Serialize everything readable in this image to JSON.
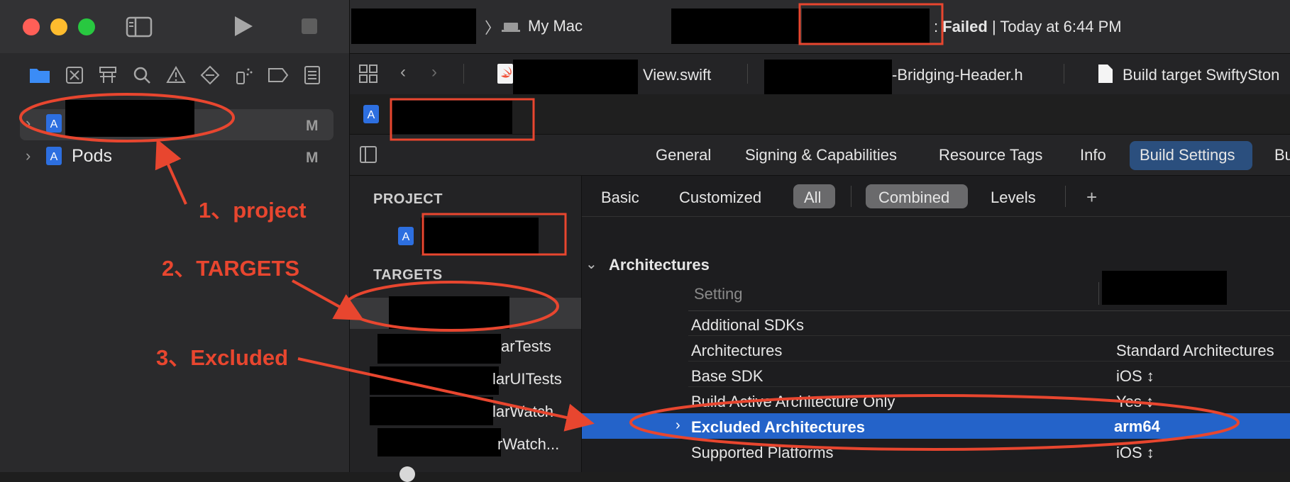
{
  "window": {
    "traffic_colors": [
      "#ff5f57",
      "#febc2e",
      "#28c840"
    ]
  },
  "navigator": {
    "items": [
      {
        "label": "",
        "badge": "M"
      },
      {
        "label": "Pods",
        "badge": "M"
      }
    ]
  },
  "activity": {
    "destination": "My Mac",
    "status_word": "Failed",
    "status_prefix": ": ",
    "status_sep": "|",
    "status_time": "Today at 6:44 PM"
  },
  "tabs": [
    {
      "label": "View.swift"
    },
    {
      "label": "-Bridging-Header.h"
    },
    {
      "label": "Build target SwiftySton"
    }
  ],
  "project_tabs": {
    "general": "General",
    "signing": "Signing & Capabilities",
    "resource_tags": "Resource Tags",
    "info": "Info",
    "build_settings": "Build Settings",
    "more": "Bu"
  },
  "filters": {
    "basic": "Basic",
    "customized": "Customized",
    "all": "All",
    "combined": "Combined",
    "levels": "Levels",
    "add": "+"
  },
  "sidebar": {
    "project_header": "PROJECT",
    "targets_header": "TARGETS",
    "targets": [
      "arTests",
      "larUITests",
      "larWatch",
      "rWatch..."
    ]
  },
  "settings": {
    "section": "Architectures",
    "column_setting": "Setting",
    "rows": [
      {
        "name": "Additional SDKs",
        "value": ""
      },
      {
        "name": "Architectures",
        "value": "Standard Architectures"
      },
      {
        "name": "Base SDK",
        "value": "iOS ↕"
      },
      {
        "name": "Build Active Architecture Only",
        "value": "Yes ↕"
      },
      {
        "name": "Excluded Architectures",
        "value": "arm64"
      },
      {
        "name": "Supported Platforms",
        "value": "iOS ↕"
      }
    ]
  },
  "annotations": {
    "a1": "1、project",
    "a2": "2、TARGETS",
    "a3": "3、Excluded",
    "color": "#e8462f"
  },
  "colors": {
    "accent": "#2463c9",
    "folder_blue": "#3b8cf6"
  }
}
